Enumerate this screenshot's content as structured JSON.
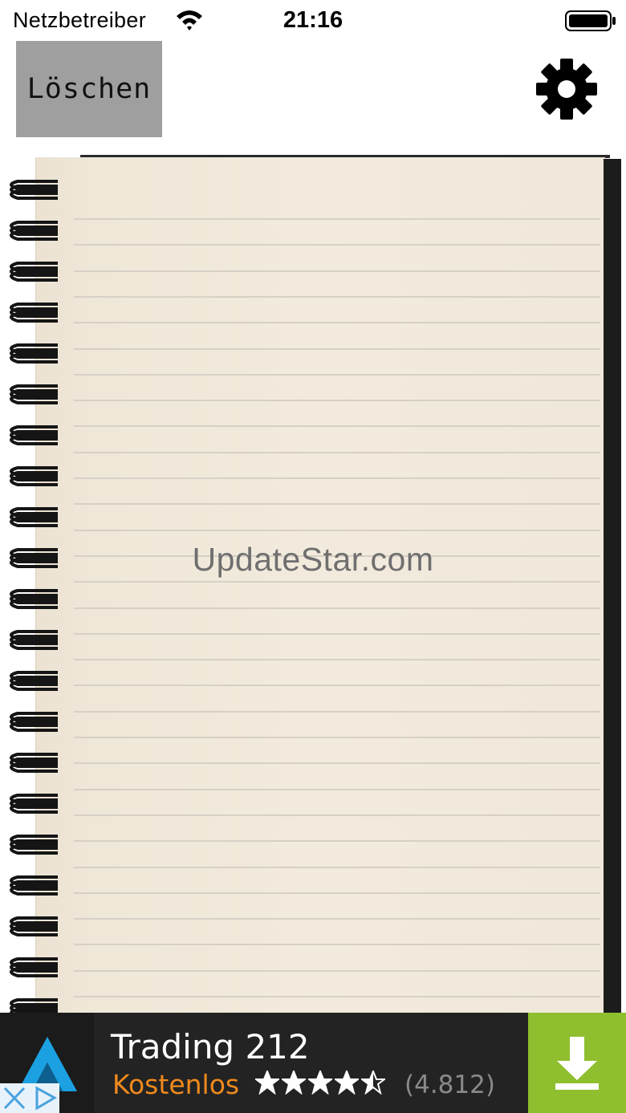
{
  "status_bar": {
    "carrier": "Netzbetreiber",
    "time": "21:16"
  },
  "header": {
    "delete_label": "Löschen",
    "settings_icon": "gear-icon"
  },
  "notebook": {
    "watermark": "UpdateStar.com"
  },
  "ad": {
    "app_name": "Trading 212",
    "price_label": "Kostenlos",
    "rating_stars": 4.5,
    "rating_count": "(4.812)",
    "logo_icon": "trading212-logo-icon",
    "download_icon": "download-arrow-icon",
    "colors": {
      "price": "#f08a1c",
      "download_bg": "#8fbf2e",
      "logo_blue": "#1ba1e2"
    }
  }
}
